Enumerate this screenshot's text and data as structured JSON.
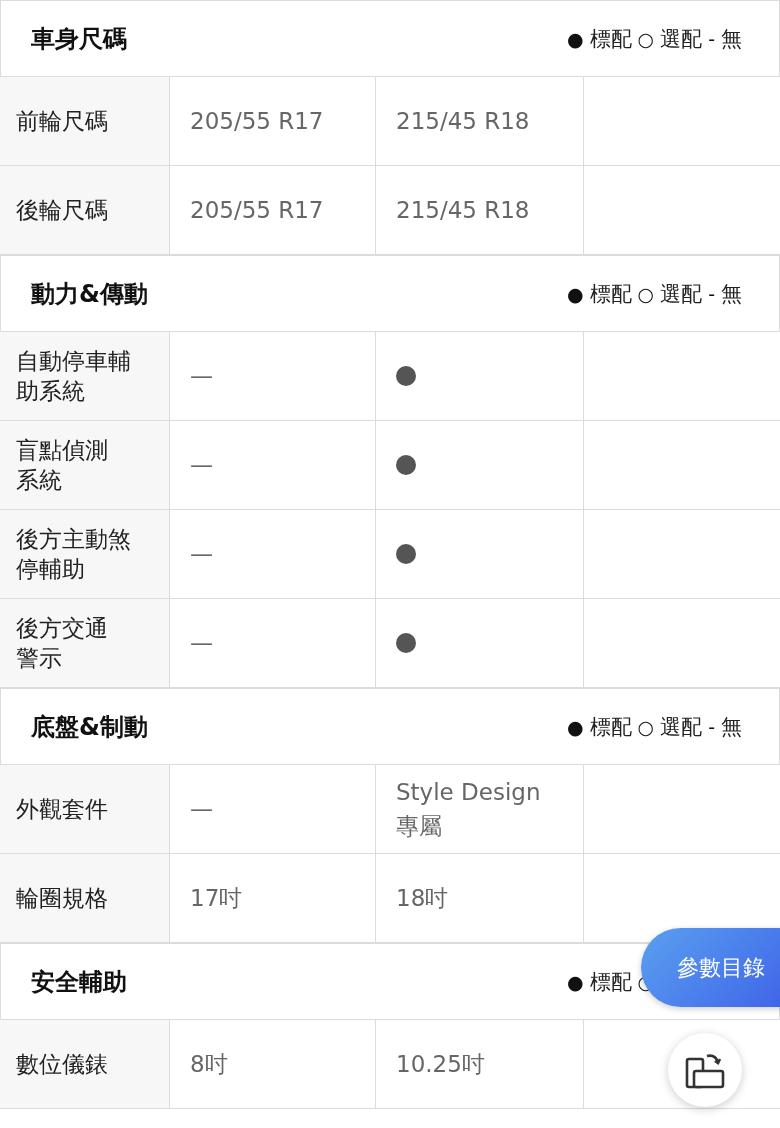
{
  "sections": [
    {
      "title": "車身尺碼",
      "legend": [
        {
          "symbol": "●",
          "label": "標配"
        },
        {
          "symbol": "○",
          "label": "選配"
        },
        {
          "symbol": "-",
          "label": "無"
        }
      ],
      "rows": [
        {
          "label": [
            "前輪尺碼"
          ],
          "cells": [
            {
              "kind": "text",
              "text": "205/55 R17"
            },
            {
              "kind": "text",
              "text": "215/45 R18"
            }
          ]
        },
        {
          "label": [
            "後輪尺碼"
          ],
          "cells": [
            {
              "kind": "text",
              "text": "205/55 R17"
            },
            {
              "kind": "text",
              "text": "215/45 R18"
            }
          ]
        }
      ]
    },
    {
      "title": "動力&傳動",
      "legend": [
        {
          "symbol": "●",
          "label": "標配"
        },
        {
          "symbol": "○",
          "label": "選配"
        },
        {
          "symbol": "-",
          "label": "無"
        }
      ],
      "rows": [
        {
          "label": [
            "自動停車輔",
            "助系統"
          ],
          "cells": [
            {
              "kind": "text",
              "text": "—"
            },
            {
              "kind": "dot"
            }
          ]
        },
        {
          "label": [
            "盲點偵測",
            "系統"
          ],
          "cells": [
            {
              "kind": "text",
              "text": "—"
            },
            {
              "kind": "dot"
            }
          ]
        },
        {
          "label": [
            "後方主動煞",
            "停輔助"
          ],
          "cells": [
            {
              "kind": "text",
              "text": "—"
            },
            {
              "kind": "dot"
            }
          ]
        },
        {
          "label": [
            "後方交通",
            "警示"
          ],
          "cells": [
            {
              "kind": "text",
              "text": "—"
            },
            {
              "kind": "dot"
            }
          ]
        }
      ]
    },
    {
      "title": "底盤&制動",
      "legend": [
        {
          "symbol": "●",
          "label": "標配"
        },
        {
          "symbol": "○",
          "label": "選配"
        },
        {
          "symbol": "-",
          "label": "無"
        }
      ],
      "rows": [
        {
          "label": [
            "外觀套件"
          ],
          "cells": [
            {
              "kind": "text",
              "text": "—"
            },
            {
              "kind": "text",
              "text": "Style Design\n專屬"
            }
          ]
        },
        {
          "label": [
            "輪圈規格"
          ],
          "cells": [
            {
              "kind": "text",
              "text": "17吋"
            },
            {
              "kind": "text",
              "text": "18吋"
            }
          ]
        }
      ]
    },
    {
      "title": "安全輔助",
      "legend": [
        {
          "symbol": "●",
          "label": "標配"
        },
        {
          "symbol": "○"
        }
      ],
      "rows": [
        {
          "label": [
            "數位儀錶"
          ],
          "cells": [
            {
              "kind": "text",
              "text": "8吋"
            },
            {
              "kind": "text",
              "text": "10.25吋"
            }
          ]
        }
      ]
    }
  ],
  "catalog_button": {
    "label": "參數目錄"
  }
}
